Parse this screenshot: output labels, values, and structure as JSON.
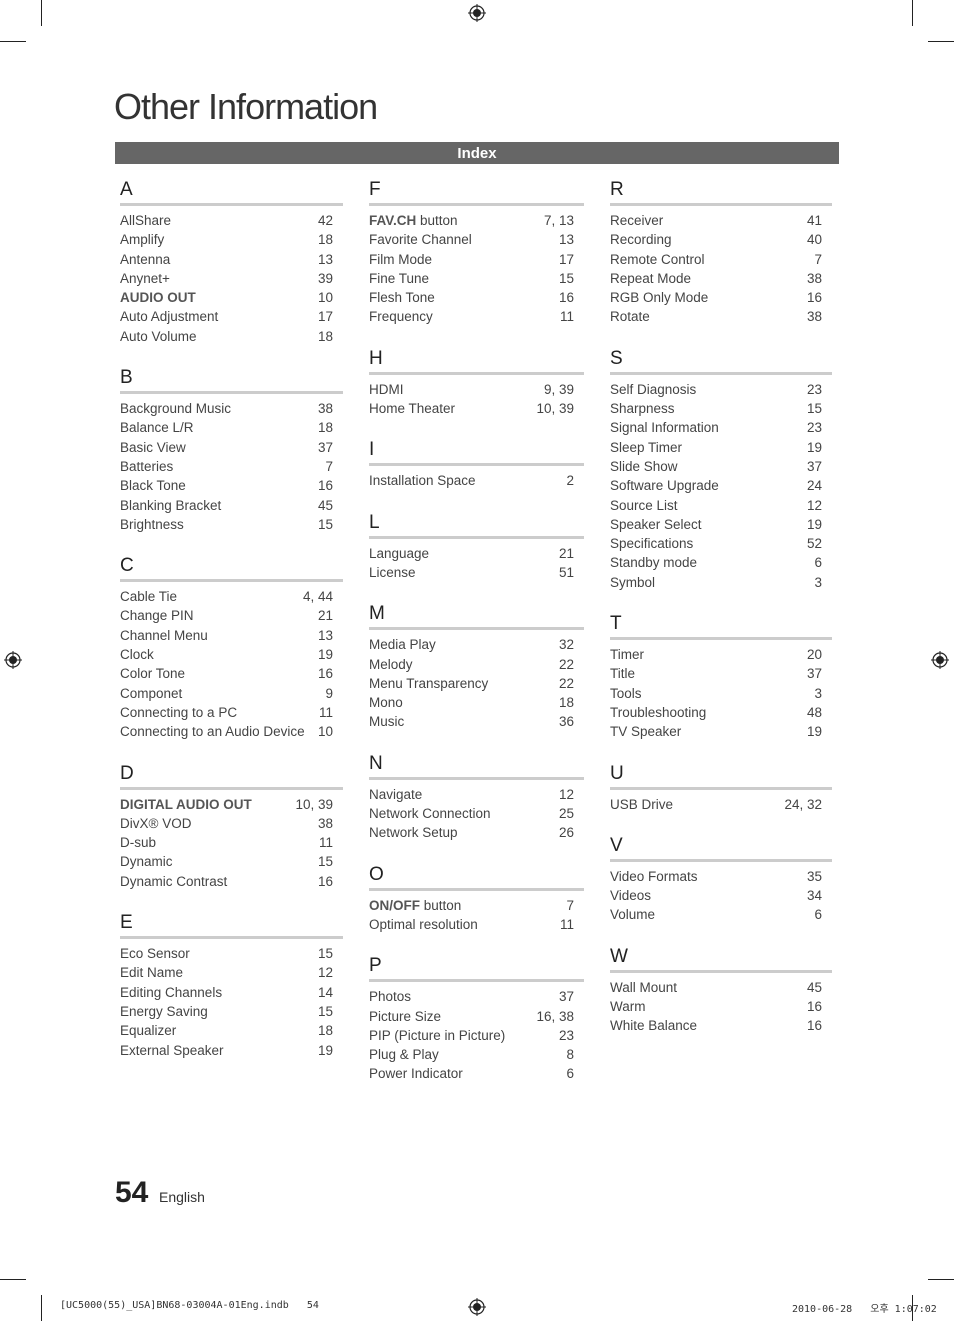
{
  "page": {
    "title": "Other Information",
    "section_bar": "Index",
    "page_number": "54",
    "language": "English"
  },
  "footer": {
    "file": "[UC5000(55)_USA]BN68-03004A-01Eng.indb   54",
    "timestamp": "2010-06-28   오후 1:07:02"
  },
  "columns": [
    [
      {
        "letter": "A",
        "entries": [
          {
            "bold": "",
            "text": "AllShare",
            "pages": "42"
          },
          {
            "bold": "",
            "text": "Amplify",
            "pages": "18"
          },
          {
            "bold": "",
            "text": "Antenna",
            "pages": "13"
          },
          {
            "bold": "",
            "text": "Anynet+",
            "pages": "39"
          },
          {
            "bold": "AUDIO OUT",
            "text": "",
            "pages": "10"
          },
          {
            "bold": "",
            "text": "Auto Adjustment",
            "pages": "17"
          },
          {
            "bold": "",
            "text": "Auto Volume",
            "pages": "18"
          }
        ]
      },
      {
        "letter": "B",
        "entries": [
          {
            "bold": "",
            "text": "Background Music",
            "pages": "38"
          },
          {
            "bold": "",
            "text": "Balance L/R",
            "pages": "18"
          },
          {
            "bold": "",
            "text": "Basic View",
            "pages": "37"
          },
          {
            "bold": "",
            "text": "Batteries",
            "pages": "7"
          },
          {
            "bold": "",
            "text": "Black Tone",
            "pages": "16"
          },
          {
            "bold": "",
            "text": "Blanking Bracket",
            "pages": "45"
          },
          {
            "bold": "",
            "text": "Brightness",
            "pages": "15"
          }
        ]
      },
      {
        "letter": "C",
        "entries": [
          {
            "bold": "",
            "text": "Cable Tie",
            "pages": "4, 44"
          },
          {
            "bold": "",
            "text": "Change PIN",
            "pages": "21"
          },
          {
            "bold": "",
            "text": "Channel Menu",
            "pages": "13"
          },
          {
            "bold": "",
            "text": "Clock",
            "pages": "19"
          },
          {
            "bold": "",
            "text": "Color Tone",
            "pages": "16"
          },
          {
            "bold": "",
            "text": "Componet",
            "pages": "9"
          },
          {
            "bold": "",
            "text": "Connecting to a PC",
            "pages": "11"
          },
          {
            "bold": "",
            "text": "Connecting to an Audio Device",
            "pages": "10"
          }
        ]
      },
      {
        "letter": "D",
        "entries": [
          {
            "bold": "DIGITAL AUDIO OUT",
            "text": "",
            "pages": "10, 39"
          },
          {
            "bold": "",
            "text": "DivX® VOD",
            "pages": "38"
          },
          {
            "bold": "",
            "text": "D-sub",
            "pages": "11"
          },
          {
            "bold": "",
            "text": "Dynamic",
            "pages": "15"
          },
          {
            "bold": "",
            "text": "Dynamic Contrast",
            "pages": "16"
          }
        ]
      },
      {
        "letter": "E",
        "entries": [
          {
            "bold": "",
            "text": "Eco Sensor",
            "pages": "15"
          },
          {
            "bold": "",
            "text": "Edit Name",
            "pages": "12"
          },
          {
            "bold": "",
            "text": "Editing Channels",
            "pages": "14"
          },
          {
            "bold": "",
            "text": "Energy Saving",
            "pages": "15"
          },
          {
            "bold": "",
            "text": "Equalizer",
            "pages": "18"
          },
          {
            "bold": "",
            "text": "External Speaker",
            "pages": "19"
          }
        ]
      }
    ],
    [
      {
        "letter": "F",
        "entries": [
          {
            "bold": "FAV.CH",
            "text": " button",
            "pages": "7, 13"
          },
          {
            "bold": "",
            "text": "Favorite Channel",
            "pages": "13"
          },
          {
            "bold": "",
            "text": "Film Mode",
            "pages": "17"
          },
          {
            "bold": "",
            "text": "Fine Tune",
            "pages": "15"
          },
          {
            "bold": "",
            "text": "Flesh Tone",
            "pages": "16"
          },
          {
            "bold": "",
            "text": "Frequency",
            "pages": "11"
          }
        ]
      },
      {
        "letter": "H",
        "entries": [
          {
            "bold": "",
            "text": "HDMI",
            "pages": "9, 39"
          },
          {
            "bold": "",
            "text": "Home Theater",
            "pages": "10, 39"
          }
        ]
      },
      {
        "letter": "I",
        "entries": [
          {
            "bold": "",
            "text": "Installation Space",
            "pages": "2"
          }
        ]
      },
      {
        "letter": "L",
        "entries": [
          {
            "bold": "",
            "text": "Language",
            "pages": "21"
          },
          {
            "bold": "",
            "text": "License",
            "pages": "51"
          }
        ]
      },
      {
        "letter": "M",
        "entries": [
          {
            "bold": "",
            "text": "Media Play",
            "pages": "32"
          },
          {
            "bold": "",
            "text": "Melody",
            "pages": "22"
          },
          {
            "bold": "",
            "text": "Menu Transparency",
            "pages": "22"
          },
          {
            "bold": "",
            "text": "Mono",
            "pages": "18"
          },
          {
            "bold": "",
            "text": "Music",
            "pages": "36"
          }
        ]
      },
      {
        "letter": "N",
        "entries": [
          {
            "bold": "",
            "text": "Navigate",
            "pages": "12"
          },
          {
            "bold": "",
            "text": "Network Connection",
            "pages": "25"
          },
          {
            "bold": "",
            "text": "Network Setup",
            "pages": "26"
          }
        ]
      },
      {
        "letter": "O",
        "entries": [
          {
            "bold": "ON/OFF",
            "text": " button",
            "pages": "7"
          },
          {
            "bold": "",
            "text": "Optimal resolution",
            "pages": "11"
          }
        ]
      },
      {
        "letter": "P",
        "entries": [
          {
            "bold": "",
            "text": "Photos",
            "pages": "37"
          },
          {
            "bold": "",
            "text": "Picture Size",
            "pages": "16, 38"
          },
          {
            "bold": "",
            "text": "PIP (Picture in Picture)",
            "pages": "23"
          },
          {
            "bold": "",
            "text": "Plug & Play",
            "pages": "8"
          },
          {
            "bold": "",
            "text": "Power Indicator",
            "pages": "6"
          }
        ]
      }
    ],
    [
      {
        "letter": "R",
        "entries": [
          {
            "bold": "",
            "text": "Receiver",
            "pages": "41"
          },
          {
            "bold": "",
            "text": "Recording",
            "pages": "40"
          },
          {
            "bold": "",
            "text": "Remote Control",
            "pages": "7"
          },
          {
            "bold": "",
            "text": "Repeat Mode",
            "pages": "38"
          },
          {
            "bold": "",
            "text": "RGB Only Mode",
            "pages": "16"
          },
          {
            "bold": "",
            "text": "Rotate",
            "pages": "38"
          }
        ]
      },
      {
        "letter": "S",
        "entries": [
          {
            "bold": "",
            "text": "Self Diagnosis",
            "pages": "23"
          },
          {
            "bold": "",
            "text": "Sharpness",
            "pages": "15"
          },
          {
            "bold": "",
            "text": "Signal Information",
            "pages": "23"
          },
          {
            "bold": "",
            "text": "Sleep Timer",
            "pages": "19"
          },
          {
            "bold": "",
            "text": "Slide Show",
            "pages": "37"
          },
          {
            "bold": "",
            "text": "Software Upgrade",
            "pages": "24"
          },
          {
            "bold": "",
            "text": "Source List",
            "pages": "12"
          },
          {
            "bold": "",
            "text": "Speaker Select",
            "pages": "19"
          },
          {
            "bold": "",
            "text": "Specifications",
            "pages": "52"
          },
          {
            "bold": "",
            "text": "Standby mode",
            "pages": "6"
          },
          {
            "bold": "",
            "text": "Symbol",
            "pages": "3"
          }
        ]
      },
      {
        "letter": "T",
        "entries": [
          {
            "bold": "",
            "text": "Timer",
            "pages": "20"
          },
          {
            "bold": "",
            "text": "Title",
            "pages": "37"
          },
          {
            "bold": "",
            "text": "Tools",
            "pages": "3"
          },
          {
            "bold": "",
            "text": "Troubleshooting",
            "pages": "48"
          },
          {
            "bold": "",
            "text": "TV Speaker",
            "pages": "19"
          }
        ]
      },
      {
        "letter": "U",
        "entries": [
          {
            "bold": "",
            "text": "USB Drive",
            "pages": "24, 32"
          }
        ]
      },
      {
        "letter": "V",
        "entries": [
          {
            "bold": "",
            "text": "Video Formats",
            "pages": "35"
          },
          {
            "bold": "",
            "text": "Videos",
            "pages": "34"
          },
          {
            "bold": "",
            "text": "Volume",
            "pages": "6"
          }
        ]
      },
      {
        "letter": "W",
        "entries": [
          {
            "bold": "",
            "text": "Wall Mount",
            "pages": "45"
          },
          {
            "bold": "",
            "text": "Warm",
            "pages": "16"
          },
          {
            "bold": "",
            "text": "White Balance",
            "pages": "16"
          }
        ]
      }
    ]
  ]
}
